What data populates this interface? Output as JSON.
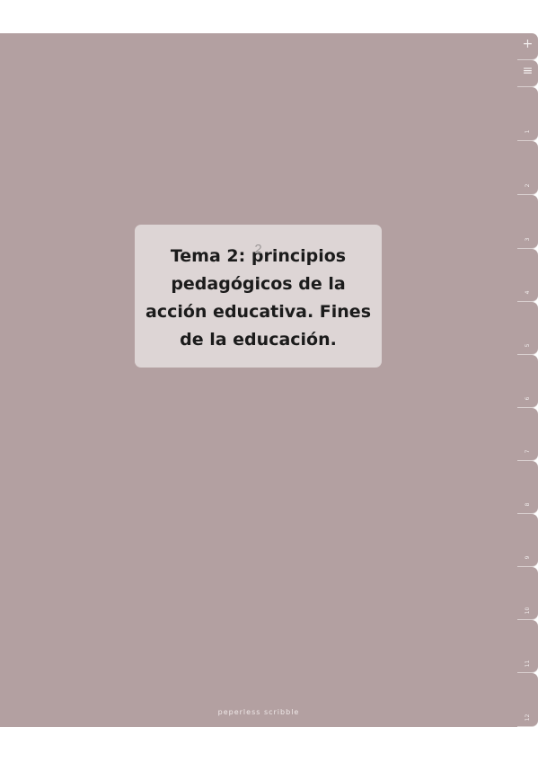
{
  "cover": {
    "page_number": "2",
    "title": "Tema 2: principios pedagógicos de la acción educativa. Fines de la educación.",
    "brand": "peperless scribble"
  },
  "tabs": {
    "add_icon": "+",
    "menu_icon": "≡",
    "labels": [
      "1",
      "2",
      "3",
      "4",
      "5",
      "6",
      "7",
      "8",
      "9",
      "10",
      "11",
      "12"
    ]
  }
}
